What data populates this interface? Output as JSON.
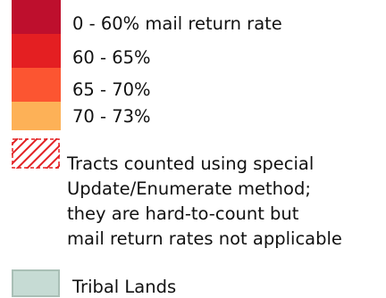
{
  "legend": {
    "rate_classes": [
      {
        "label": "0 - 60% mail return rate",
        "color": "#be0f2d"
      },
      {
        "label": "60 - 65%",
        "color": "#e41f22"
      },
      {
        "label": "65 - 70%",
        "color": "#fc5531"
      },
      {
        "label": "70 - 73%",
        "color": "#fdb157"
      }
    ],
    "hatch": {
      "color": "#e32224",
      "lines": [
        "Tracts counted using special",
        "Update/Enumerate method;",
        "they are hard-to-count but",
        "mail return rates not applicable"
      ]
    },
    "tribal": {
      "label": "Tribal Lands",
      "color": "#c6dbd4"
    }
  }
}
